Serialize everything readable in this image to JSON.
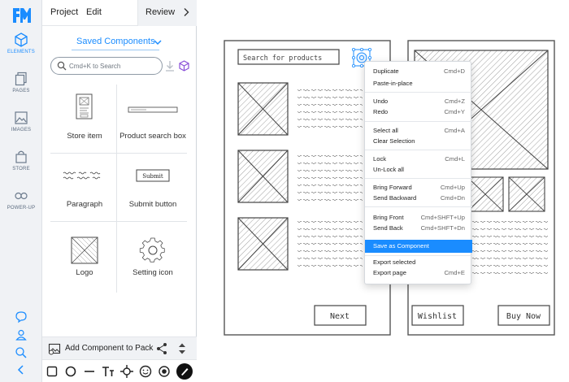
{
  "menubar": {
    "project": "Project",
    "edit": "Edit",
    "review": "Review"
  },
  "rail": {
    "elements": "ELEMENTS",
    "pages": "PAGES",
    "images": "IMAGES",
    "store": "STORE",
    "powerup": "POWER-UP"
  },
  "panel": {
    "title": "Saved Components",
    "search_placeholder": "Cmd+K to Search",
    "components": [
      {
        "label": "Store item",
        "icon": "phone-wireframe-icon"
      },
      {
        "label": "Product search box",
        "icon": "search-box-icon"
      },
      {
        "label": "Paragraph",
        "icon": "scribble-text-icon"
      },
      {
        "label": "Submit button",
        "icon": "submit-button-icon"
      },
      {
        "label": "Logo",
        "icon": "crossed-box-icon"
      },
      {
        "label": "Setting icon",
        "icon": "gear-icon"
      }
    ],
    "thumb_texts": {
      "submit": "Submit"
    },
    "pack_label": "Add Component to Pack"
  },
  "canvas": {
    "search_placeholder": "Search for products",
    "next": "Next",
    "wishlist": "Wishlist",
    "buy_now": "Buy Now"
  },
  "context_menu": [
    {
      "label": "Duplicate",
      "shortcut": "Cmd+D"
    },
    {
      "label": "Paste-in-place",
      "shortcut": ""
    },
    {
      "label": "Undo",
      "shortcut": "Cmd+Z"
    },
    {
      "label": "Redo",
      "shortcut": "Cmd+Y"
    },
    {
      "label": "Select all",
      "shortcut": "Cmd+A"
    },
    {
      "label": "Clear Selection",
      "shortcut": ""
    },
    {
      "label": "Lock",
      "shortcut": "Cmd+L"
    },
    {
      "label": "Un-Lock all",
      "shortcut": ""
    },
    {
      "label": "Bring Forward",
      "shortcut": "Cmd+Up"
    },
    {
      "label": "Send Backward",
      "shortcut": "Cmd+Dn"
    },
    {
      "label": "Bring Front",
      "shortcut": "Cmd+SHFT+Up"
    },
    {
      "label": "Send Back",
      "shortcut": "Cmd+SHFT+Dn"
    },
    {
      "label": "Save as Component",
      "shortcut": ""
    },
    {
      "label": "Export selected",
      "shortcut": ""
    },
    {
      "label": "Export page",
      "shortcut": "Cmd+E"
    }
  ],
  "colors": {
    "accent": "#1a8cff",
    "rail_bg": "#f0f2f5"
  }
}
